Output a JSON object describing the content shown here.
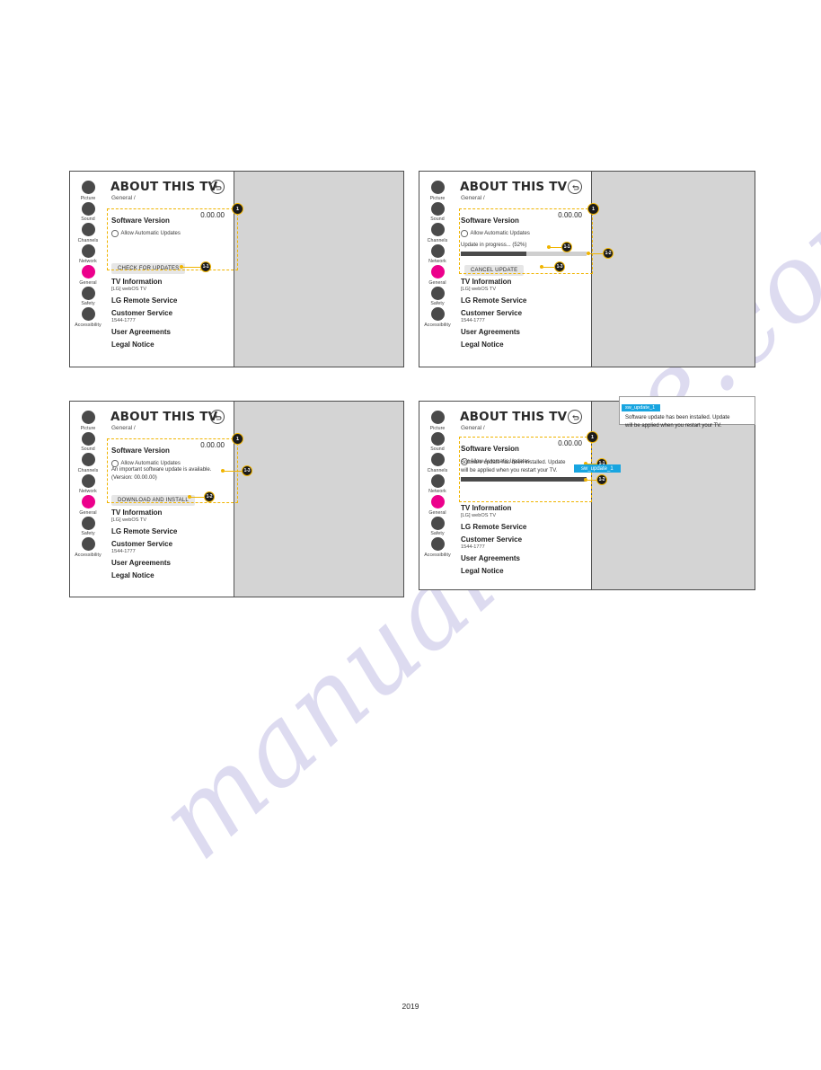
{
  "document": {
    "footer_page": "2019",
    "watermark": "manualshive.com"
  },
  "colors": {
    "accent_pink": "#ec008c",
    "annotation_gold": "#f0b400",
    "tooltip_cyan": "#18a5e0",
    "panel_gray": "#d4d4d4"
  },
  "ui": {
    "title": "ABOUT THIS TV",
    "breadcrumb": "General /",
    "back_icon": "back-arrow-icon",
    "sidebar": [
      {
        "label": "Picture",
        "icon": "picture-icon",
        "active": false
      },
      {
        "label": "Sound",
        "icon": "sound-icon",
        "active": false
      },
      {
        "label": "Channels",
        "icon": "channels-icon",
        "active": false
      },
      {
        "label": "Network",
        "icon": "network-icon",
        "active": false
      },
      {
        "label": "General",
        "icon": "general-icon",
        "active": true
      },
      {
        "label": "Safety",
        "icon": "safety-icon",
        "active": false
      },
      {
        "label": "Accessibility",
        "icon": "accessibility-icon",
        "active": false
      }
    ],
    "software_version_label": "Software Version",
    "software_version_value": "0.00.00",
    "allow_auto_updates_label": "Allow Automatic Updates",
    "menu": [
      {
        "main": "TV Information",
        "sub": "[LG] webOS TV"
      },
      {
        "main": "LG Remote Service",
        "sub": ""
      },
      {
        "main": "Customer Service",
        "sub": "1544-1777"
      },
      {
        "main": "User Agreements",
        "sub": ""
      },
      {
        "main": "Legal Notice",
        "sub": ""
      }
    ]
  },
  "panels": [
    {
      "id": "panel-check-for-updates",
      "button_label": "CHECK FOR UPDATES",
      "badges": [
        {
          "id": "badge-1",
          "text": "1"
        },
        {
          "id": "badge-1-1",
          "text": "1-1"
        }
      ]
    },
    {
      "id": "panel-update-in-progress",
      "progress_label": "Update in progress... (52%)",
      "progress_percent": 52,
      "button_label": "CANCEL UPDATE",
      "badges": [
        {
          "id": "badge-1",
          "text": "1"
        },
        {
          "id": "badge-1-1",
          "text": "1-1"
        },
        {
          "id": "badge-1-2",
          "text": "1-2"
        },
        {
          "id": "badge-1-3",
          "text": "1-3"
        }
      ]
    },
    {
      "id": "panel-update-available",
      "note_line_1": "An important software update is available.",
      "note_line_2": "(Version: 00.00.00)",
      "button_label": "DOWNLOAD AND INSTALL",
      "badges": [
        {
          "id": "badge-1",
          "text": "1"
        },
        {
          "id": "badge-1-2",
          "text": "1-2"
        },
        {
          "id": "badge-1-3",
          "text": "1-3"
        }
      ]
    },
    {
      "id": "panel-update-installed",
      "note_line_1": "Software update has been installed. Update",
      "note_line_2": "will be applied when you restart your TV.",
      "progress_percent": 100,
      "tag_label": "sw_update_1",
      "tooltip": {
        "header": "sw_update_1",
        "line_1": "Software update has been installed. Update",
        "line_2": "will be applied when you restart your TV."
      },
      "badges": [
        {
          "id": "badge-1",
          "text": "1"
        },
        {
          "id": "badge-1-1",
          "text": "1-1"
        },
        {
          "id": "badge-1-2",
          "text": "1-2"
        }
      ]
    }
  ]
}
